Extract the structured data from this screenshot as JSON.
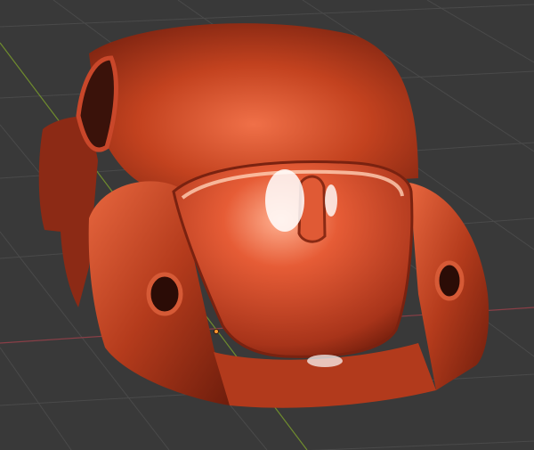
{
  "viewport": {
    "background_color": "#393939",
    "grid_line_color": "#4a4a4a",
    "x_axis_color": "#8a3f47",
    "y_axis_color": "#6f8c2e",
    "model": {
      "icon": "car-body-icon",
      "material_color": "#c8432a"
    }
  }
}
